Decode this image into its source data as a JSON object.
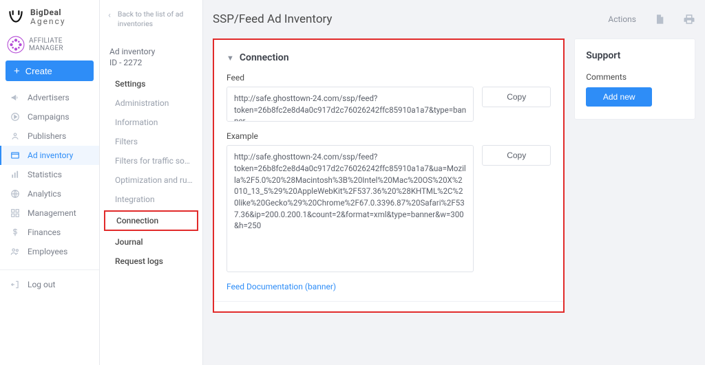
{
  "brand": {
    "line1": "BigDeal",
    "line2": "Agency"
  },
  "user": {
    "role": "AFFILIATE MANAGER"
  },
  "create_label": "Create",
  "nav": {
    "items": [
      {
        "label": "Advertisers"
      },
      {
        "label": "Campaigns"
      },
      {
        "label": "Publishers"
      },
      {
        "label": "Ad inventory"
      },
      {
        "label": "Statistics"
      },
      {
        "label": "Analytics"
      },
      {
        "label": "Management"
      },
      {
        "label": "Finances"
      },
      {
        "label": "Employees"
      }
    ],
    "logout": "Log out"
  },
  "back_text": "Back to the list of ad inventories",
  "adinv": {
    "title": "Ad inventory",
    "id_line": "ID - 2272"
  },
  "subnav": [
    "Settings",
    "Administration",
    "Information",
    "Filters",
    "Filters for traffic sour…",
    "Optimization and rules",
    "Integration",
    "Connection",
    "Journal",
    "Request logs"
  ],
  "header": {
    "title": "SSP/Feed Ad Inventory",
    "actions_label": "Actions"
  },
  "connection": {
    "section_title": "Connection",
    "feed_label": "Feed",
    "feed_value": "http://safe.ghosttown-24.com/ssp/feed?token=26b8fc2e8d4a0c917d2c76026242ffc85910a1a7&type=banner",
    "example_label": "Example",
    "example_value": "http://safe.ghosttown-24.com/ssp/feed?token=26b8fc2e8d4a0c917d2c76026242ffc85910a1a7&ua=Mozilla%2F5.0%20%28Macintosh%3B%20Intel%20Mac%20OS%20X%2010_13_5%29%20AppleWebKit%2F537.36%20%28KHTML%2C%20like%20Gecko%29%20Chrome%2F67.0.3396.87%20Safari%2F537.36&ip=200.0.200.1&count=2&format=xml&type=banner&w=300&h=250",
    "copy_label": "Copy",
    "doc_link": "Feed Documentation (banner)"
  },
  "support": {
    "title": "Support",
    "comments": "Comments",
    "add_new": "Add new"
  }
}
